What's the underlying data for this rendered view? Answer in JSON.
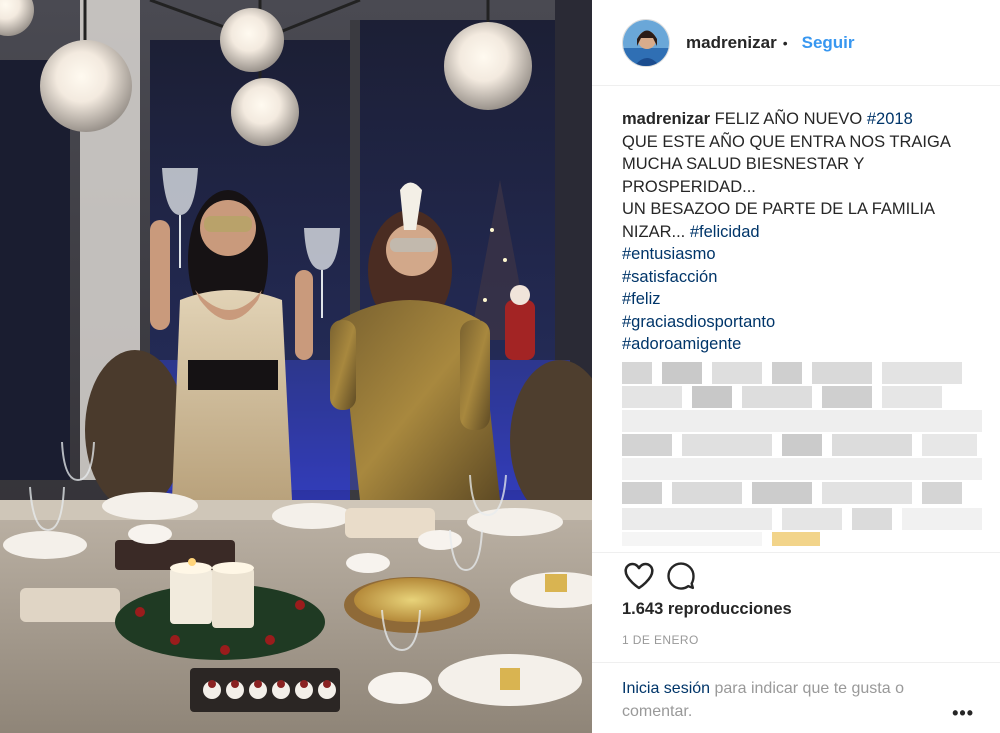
{
  "post": {
    "username": "madrenizar",
    "separator": "•",
    "follow_label": "Seguir",
    "caption": {
      "user": "madrenizar",
      "line1": "FELIZ AÑO NUEVO",
      "line1_tag": "#2018",
      "line2": "QUE ESTE AÑO QUE ENTRA NOS TRAIGA",
      "line3": "MUCHA SALUD BIESNESTAR Y",
      "line4": "PROSPERIDAD...",
      "line5": "UN BESAZOO DE PARTE DE LA FAMILIA",
      "line6": "NIZAR...",
      "line6_tag": "#felicidad",
      "hashtags": [
        "#entusiasmo",
        "#satisfacción",
        "#feliz",
        "#graciasdiosportanto",
        "#adoroamigente"
      ]
    },
    "views_count": "1.643",
    "views_label": "reproducciones",
    "date": "1 DE ENERO",
    "login": {
      "link": "Inicia sesión",
      "rest": "para indicar que te gusta o comentar."
    },
    "more_label": "•••"
  },
  "icons": {
    "like": "heart-icon",
    "comment": "comment-icon",
    "more": "more-options-icon"
  },
  "colors": {
    "link_blue": "#3897f0",
    "hashtag": "#003569",
    "muted": "#999999",
    "text": "#262626"
  }
}
